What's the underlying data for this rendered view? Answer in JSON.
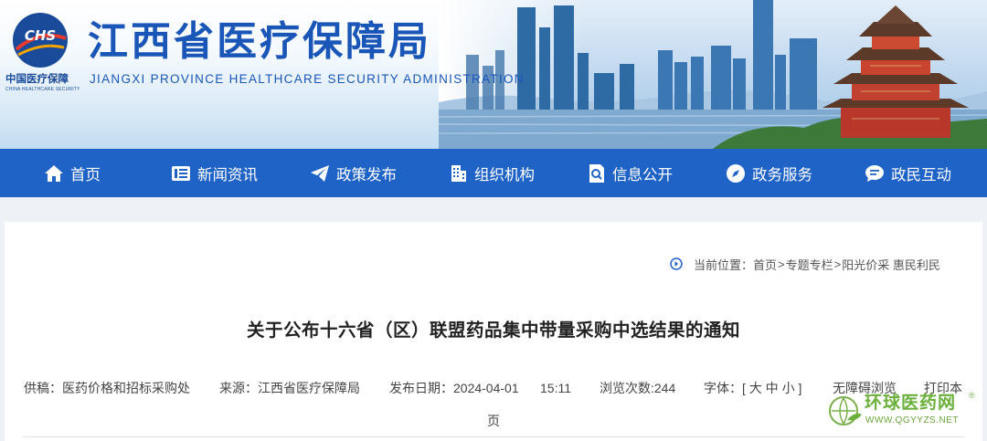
{
  "header": {
    "logo_text": "CHS",
    "logo_sub_cn": "中国医疗保障",
    "logo_sub_en": "CHINA HEALTHCARE SECURITY",
    "title_cn": "江西省医疗保障局",
    "title_en": "JIANGXI PROVINCE HEALTHCARE SECURITY ADMINISTRATION"
  },
  "nav": {
    "items": [
      {
        "label": "首页",
        "icon": "home-icon"
      },
      {
        "label": "新闻资讯",
        "icon": "news-icon"
      },
      {
        "label": "政策发布",
        "icon": "paper-plane-icon"
      },
      {
        "label": "组织机构",
        "icon": "building-icon"
      },
      {
        "label": "信息公开",
        "icon": "document-search-icon"
      },
      {
        "label": "政务服务",
        "icon": "compass-icon"
      },
      {
        "label": "政民互动",
        "icon": "chat-icon"
      }
    ]
  },
  "breadcrumb": {
    "prefix": "当前位置：",
    "items": [
      "首页",
      "专题专栏",
      "阳光价采 惠民利民"
    ],
    "separator": ">"
  },
  "article": {
    "title": "关于公布十六省（区）联盟药品集中带量采购中选结果的通知",
    "meta": {
      "contributor_label": "供稿：",
      "contributor": "医药价格和招标采购处",
      "source_label": "来源：",
      "source": "江西省医疗保障局",
      "date_label": "发布日期：",
      "date": "2024-04-01",
      "time": "15:11",
      "views_label": "浏览次数:",
      "views": "244",
      "font_label": "字体：",
      "font_open": "[",
      "font_large": "大",
      "font_medium": "中",
      "font_small": "小",
      "font_close": "]",
      "accessible": "无障碍浏览",
      "print": "打印本",
      "print_wrap": "页"
    }
  },
  "watermark": {
    "cn": "环球医药网",
    "en": "WWW.QGYYZS.NET",
    "reg": "®"
  },
  "colors": {
    "brand_blue": "#1f63c6",
    "title_blue": "#1a56b8",
    "watermark_green": "#6ab03a"
  }
}
